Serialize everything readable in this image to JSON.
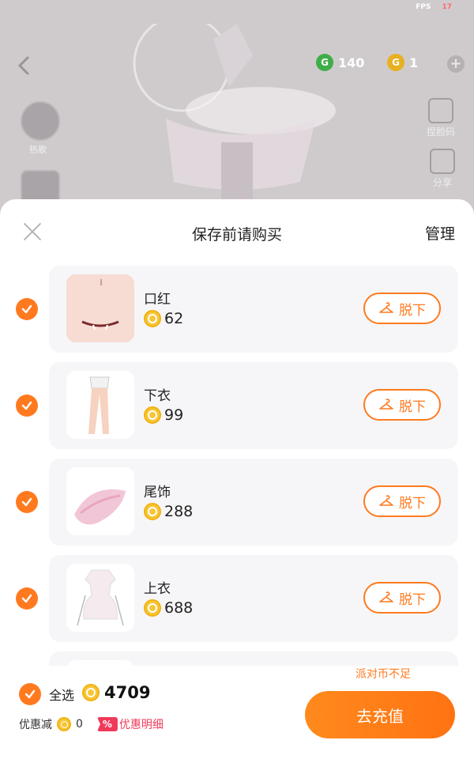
{
  "status": {
    "fps_label": "FPS",
    "fps_value": "17"
  },
  "background": {
    "currency_green": "140",
    "currency_gold": "1",
    "left_icon_label": "热歌",
    "side_items": [
      {
        "label": "捏脸码",
        "icon": "qr-edit-icon"
      },
      {
        "label": "分享",
        "icon": "share-icon"
      }
    ]
  },
  "sheet": {
    "title": "保存前请购买",
    "manage_label": "管理",
    "items": [
      {
        "name": "口红",
        "price": "62",
        "action": "脱下",
        "thumb": "lipstick-thumbnail"
      },
      {
        "name": "下衣",
        "price": "99",
        "action": "脱下",
        "thumb": "bottoms-thumbnail"
      },
      {
        "name": "尾饰",
        "price": "288",
        "action": "脱下",
        "thumb": "tail-thumbnail"
      },
      {
        "name": "上衣",
        "price": "688",
        "action": "脱下",
        "thumb": "top-thumbnail"
      }
    ]
  },
  "footer": {
    "insufficient": "派对币不足",
    "select_all": "全选",
    "total": "4709",
    "discount_label": "优惠减",
    "discount_value": "0",
    "discount_detail": "优惠明细",
    "recharge_label": "去充值"
  },
  "colors": {
    "accent": "#ff7a1f",
    "coin": "#f7c637",
    "discount": "#f0395a"
  }
}
